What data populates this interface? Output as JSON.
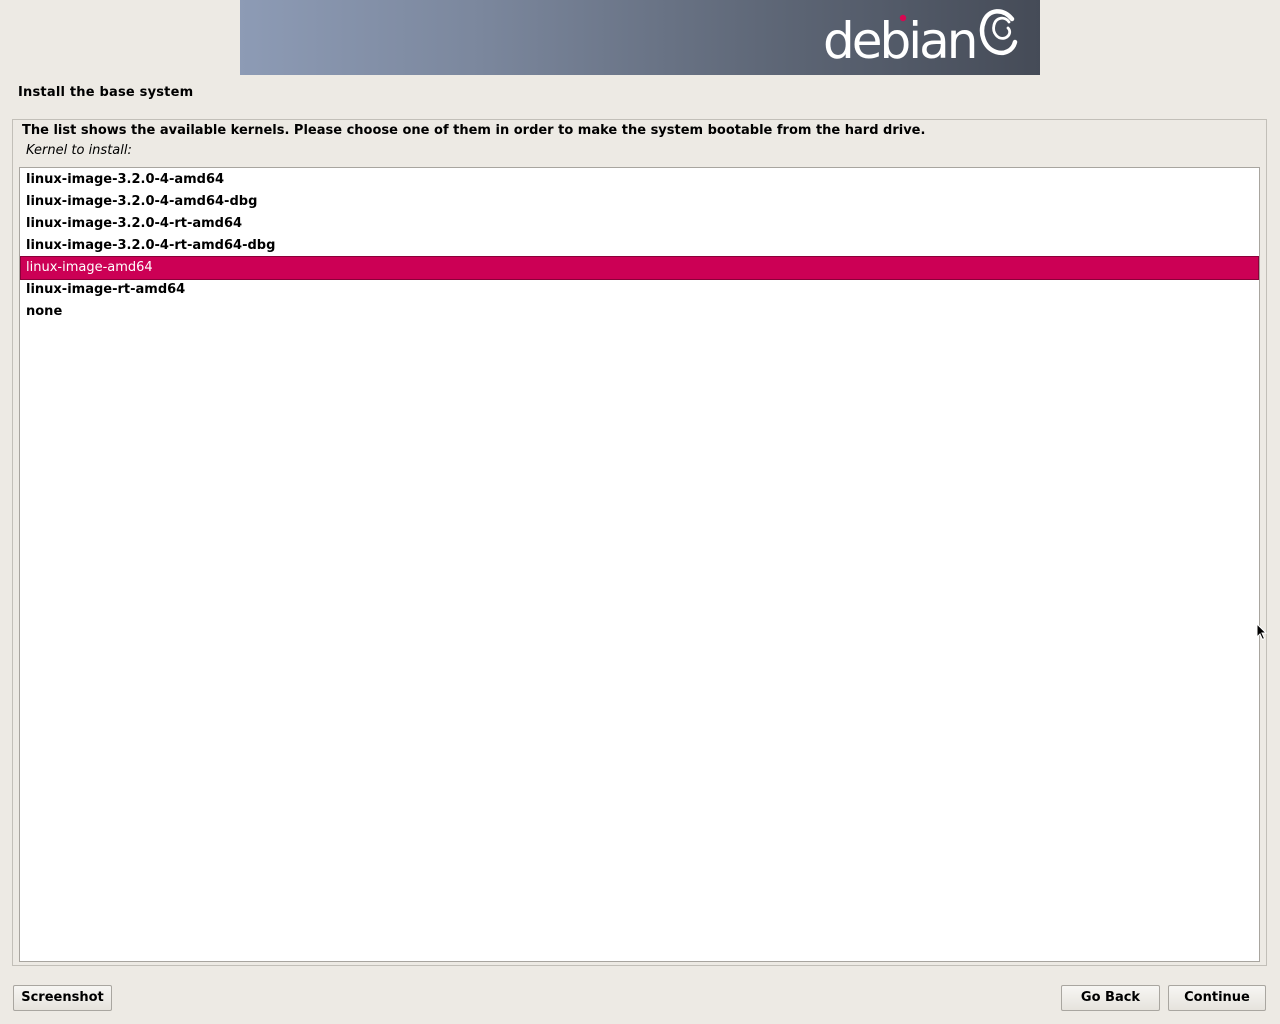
{
  "header": {
    "logo_text": "debian",
    "logo_text_color": "#ffffff",
    "logo_dot_color": "#d70751",
    "swirl_icon": "debian-swirl-icon"
  },
  "step": {
    "title": "Install the base system"
  },
  "question": {
    "description": "The list shows the available kernels. Please choose one of them in order to make the system bootable from the hard drive.",
    "prompt": "Kernel to install:"
  },
  "kernel_list": {
    "items": [
      {
        "label": "linux-image-3.2.0-4-amd64",
        "selected": false
      },
      {
        "label": "linux-image-3.2.0-4-amd64-dbg",
        "selected": false
      },
      {
        "label": "linux-image-3.2.0-4-rt-amd64",
        "selected": false
      },
      {
        "label": "linux-image-3.2.0-4-rt-amd64-dbg",
        "selected": false
      },
      {
        "label": "linux-image-amd64",
        "selected": true
      },
      {
        "label": "linux-image-rt-amd64",
        "selected": false
      },
      {
        "label": "none",
        "selected": false
      }
    ],
    "selected_color": "#cc0055"
  },
  "buttons": {
    "screenshot": "Screenshot",
    "go_back": "Go Back",
    "continue": "Continue"
  },
  "pointer_icon": "mouse-pointer-icon"
}
